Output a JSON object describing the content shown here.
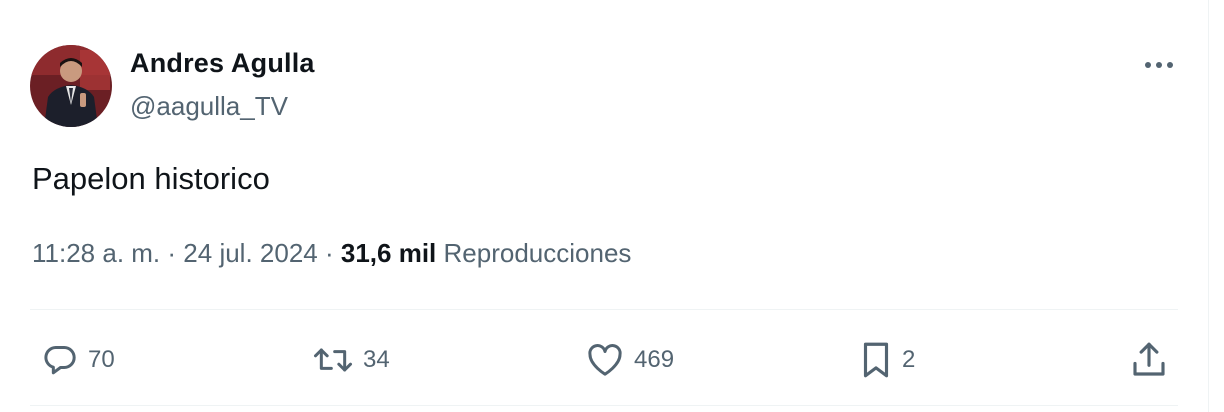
{
  "author": {
    "name": "Andres Agulla",
    "handle": "@aagulla_TV"
  },
  "tweet": {
    "text": "Papelon historico"
  },
  "meta": {
    "time": "11:28 a. m.",
    "date": "24 jul. 2024",
    "separator": "·",
    "views_count": "31,6 mil",
    "views_label": "Reproducciones"
  },
  "actions": {
    "replies": "70",
    "retweets": "34",
    "likes": "469",
    "bookmarks": "2"
  },
  "icons": {
    "more": "more-horizontal-icon",
    "reply": "comment-icon",
    "retweet": "retweet-icon",
    "like": "heart-icon",
    "bookmark": "bookmark-icon",
    "share": "share-icon"
  },
  "colors": {
    "text_primary": "#0f1419",
    "text_secondary": "#536471",
    "divider": "#eff3f4"
  }
}
